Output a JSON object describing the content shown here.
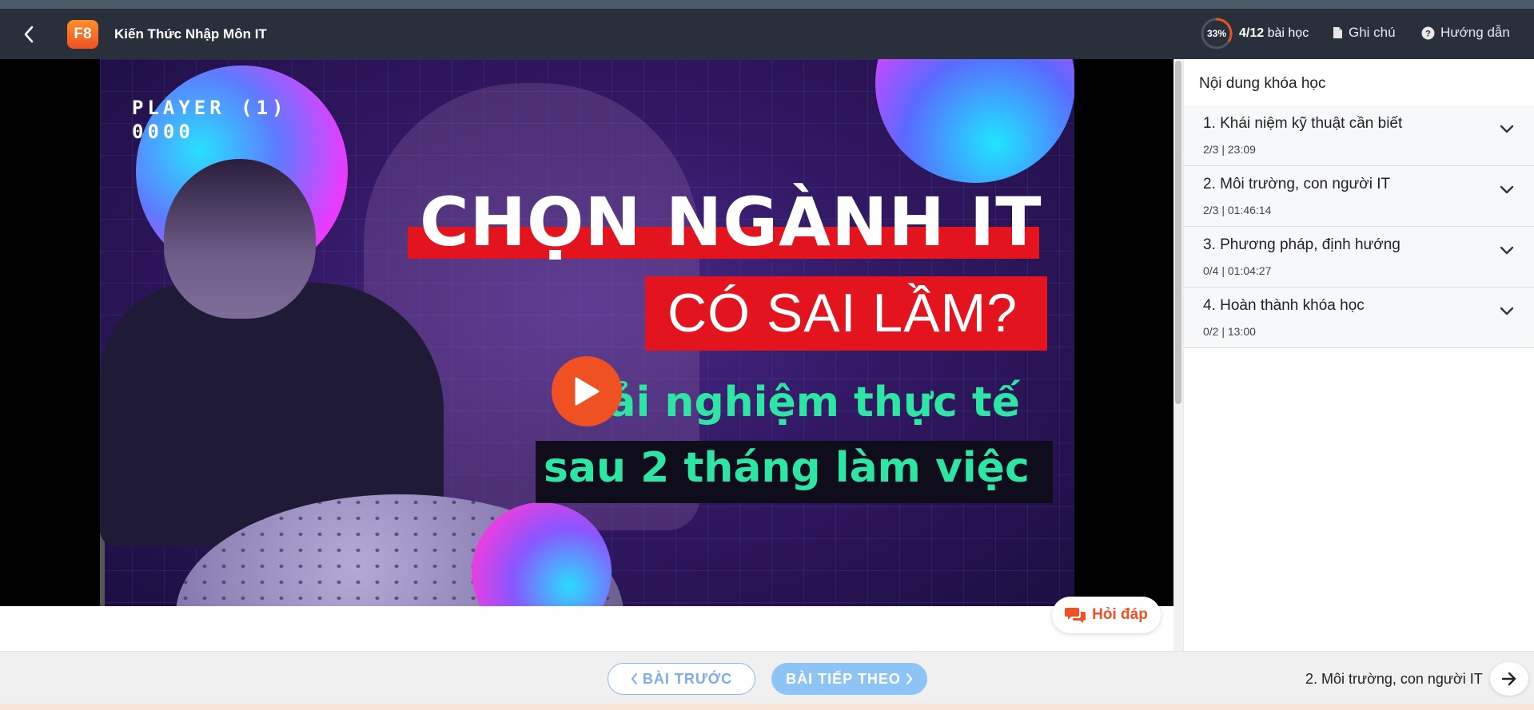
{
  "header": {
    "logo_text": "F8",
    "course_title": "Kiến Thức Nhập Môn IT",
    "progress_percent": "33%",
    "progress_value": 0.33,
    "lessons_done": "4/12",
    "lessons_suffix": "bài học",
    "notes_label": "Ghi chú",
    "guide_label": "Hướng dẫn"
  },
  "video": {
    "player_line1": "PLAYER (1)",
    "player_line2": "0000",
    "headline": "CHỌN NGÀNH IT",
    "question": "CÓ SAI LẦM?",
    "sub_line1": "Trải nghiệm thực tế",
    "sub_line2": "sau 2 tháng làm việc"
  },
  "qa": {
    "label": "Hỏi đáp"
  },
  "sidebar": {
    "title": "Nội dung khóa học",
    "sections": [
      {
        "title": "1. Khái niệm kỹ thuật cần biết",
        "meta": "2/3 | 23:09"
      },
      {
        "title": "2. Môi trường, con người IT",
        "meta": "2/3 | 01:46:14"
      },
      {
        "title": "3. Phương pháp, định hướng",
        "meta": "0/4 | 01:04:27"
      },
      {
        "title": "4. Hoàn thành khóa học",
        "meta": "0/2 | 13:00"
      }
    ]
  },
  "footer": {
    "prev_label": "BÀI TRƯỚC",
    "next_label": "BÀI TIẾP THEO",
    "next_lesson_title": "2. Môi trường, con người IT"
  },
  "colors": {
    "brand": "#f05123",
    "header_bg": "#29303b",
    "accent_blue": "#8ec3f5"
  }
}
